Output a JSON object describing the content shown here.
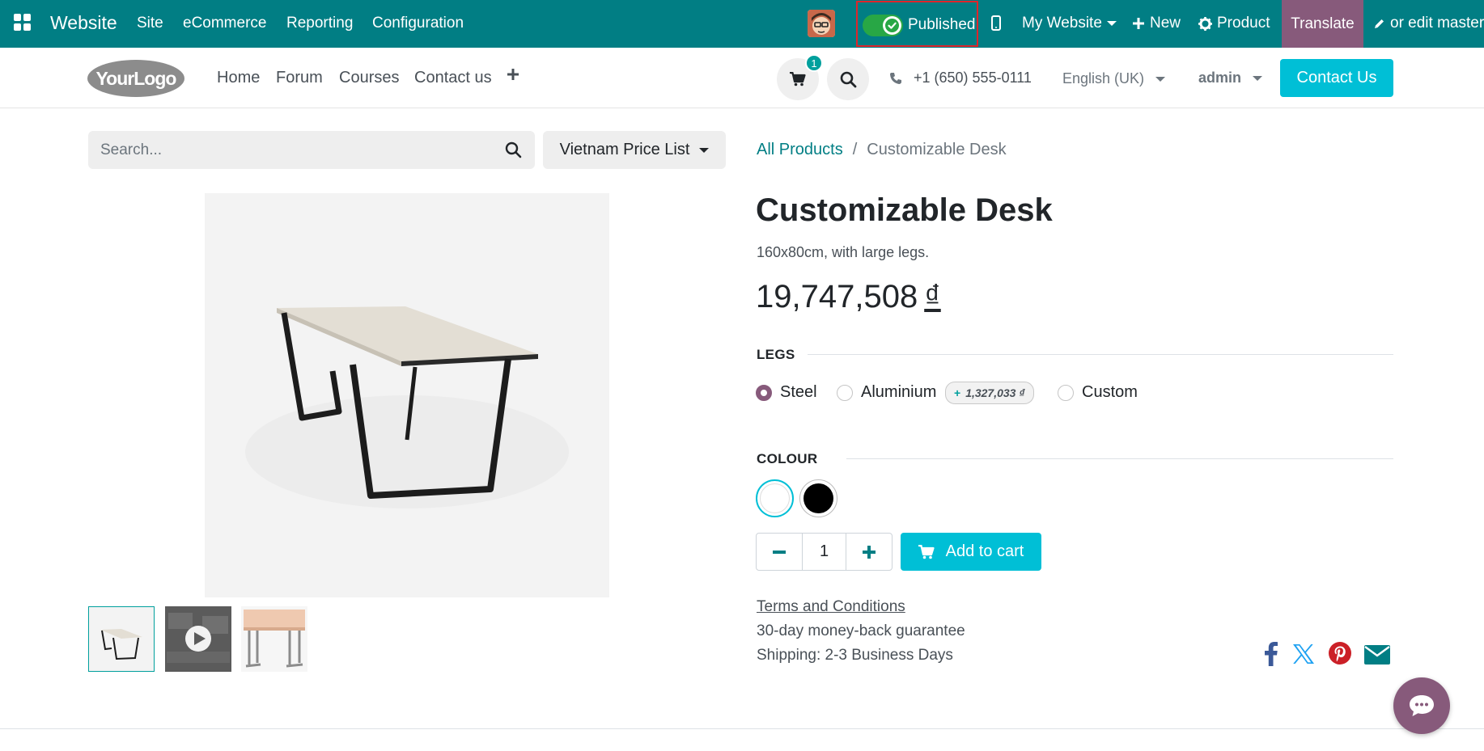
{
  "topbar": {
    "brand": "Website",
    "menu": [
      "Site",
      "eCommerce",
      "Reporting",
      "Configuration"
    ],
    "published_label": "Published",
    "my_website_label": "My Website",
    "new_label": "New",
    "product_label": "Product",
    "translate_label": "Translate",
    "edit_master_label": "or edit master"
  },
  "header": {
    "logo_text": "YourLogo",
    "nav": [
      "Home",
      "Forum",
      "Courses",
      "Contact us"
    ],
    "cart_count": "1",
    "phone": "+1 (650) 555-0111",
    "language": "English (UK)",
    "user": "admin",
    "contact_button": "Contact Us"
  },
  "search": {
    "placeholder": "Search...",
    "pricelist": "Vietnam Price List"
  },
  "breadcrumb": {
    "parent": "All Products",
    "separator": "/",
    "current": "Customizable Desk"
  },
  "product": {
    "name": "Customizable Desk",
    "description": "160x80cm, with large legs.",
    "price": "19,747,508",
    "currency": "₫"
  },
  "legs": {
    "label": "LEGS",
    "options": [
      "Steel",
      "Aluminium",
      "Custom"
    ],
    "selected": "Steel",
    "aluminium_extra": "1,327,033 ₫"
  },
  "colour": {
    "label": "COLOUR",
    "swatches": [
      "#ffffff",
      "#000000"
    ],
    "selected": "#ffffff"
  },
  "cart": {
    "quantity": "1",
    "add_label": "Add to cart"
  },
  "info": {
    "terms": "Terms and Conditions",
    "guarantee": "30-day money-back guarantee",
    "shipping": "Shipping: 2-3 Business Days"
  },
  "share_icons": [
    "facebook-icon",
    "x-twitter-icon",
    "pinterest-icon",
    "email-icon"
  ],
  "colors": {
    "topbar": "#017e84",
    "accent": "#00bfd6",
    "odoo_purple": "#875a7b",
    "published_highlight": "#e0252b"
  }
}
